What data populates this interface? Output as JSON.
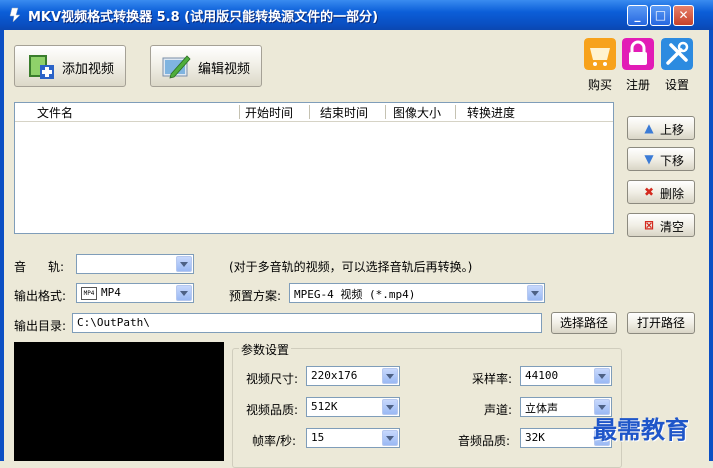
{
  "window": {
    "title": "MKV视频格式转换器 5.8 (试用版只能转换源文件的一部分)"
  },
  "toolbar": {
    "add_video": "添加视频",
    "edit_video": "编辑视频"
  },
  "top_actions": {
    "buy": "购买",
    "register": "注册",
    "settings": "设置"
  },
  "file_list": {
    "columns": [
      "文件名",
      "开始时间",
      "结束时间",
      "图像大小",
      "转换进度"
    ],
    "rows": []
  },
  "side_buttons": {
    "move_up": "上移",
    "move_down": "下移",
    "delete": "删除",
    "clear": "清空"
  },
  "audio_track": {
    "label_a": "音",
    "label_b": "轨:",
    "value": "",
    "hint": "(对于多音轨的视频，可以选择音轨后再转换。)"
  },
  "output_format": {
    "label": "输出格式:",
    "chip": "MP4",
    "value": "MP4"
  },
  "preset": {
    "label": "预置方案:",
    "value": "MPEG-4 视频 (*.mp4)"
  },
  "output_dir": {
    "label": "输出目录:",
    "value": "C:\\OutPath\\",
    "choose_button": "选择路径",
    "open_button": "打开路径"
  },
  "params": {
    "legend": "参数设置",
    "video_size_label": "视频尺寸:",
    "video_size": "220x176",
    "video_quality_label": "视频品质:",
    "video_quality": "512K",
    "fps_label": "帧率/秒:",
    "fps": "15",
    "sample_rate_label": "采样率:",
    "sample_rate": "44100",
    "channels_label": "声道:",
    "channels": "立体声",
    "audio_quality_label": "音频品质:",
    "audio_quality": "32K"
  },
  "watermark": "最需教育",
  "colors": {
    "titlebar": "#0b5ed8",
    "window_bg": "#ece9d8",
    "field_border": "#7f9db9",
    "watermark": "#1f56c9"
  }
}
